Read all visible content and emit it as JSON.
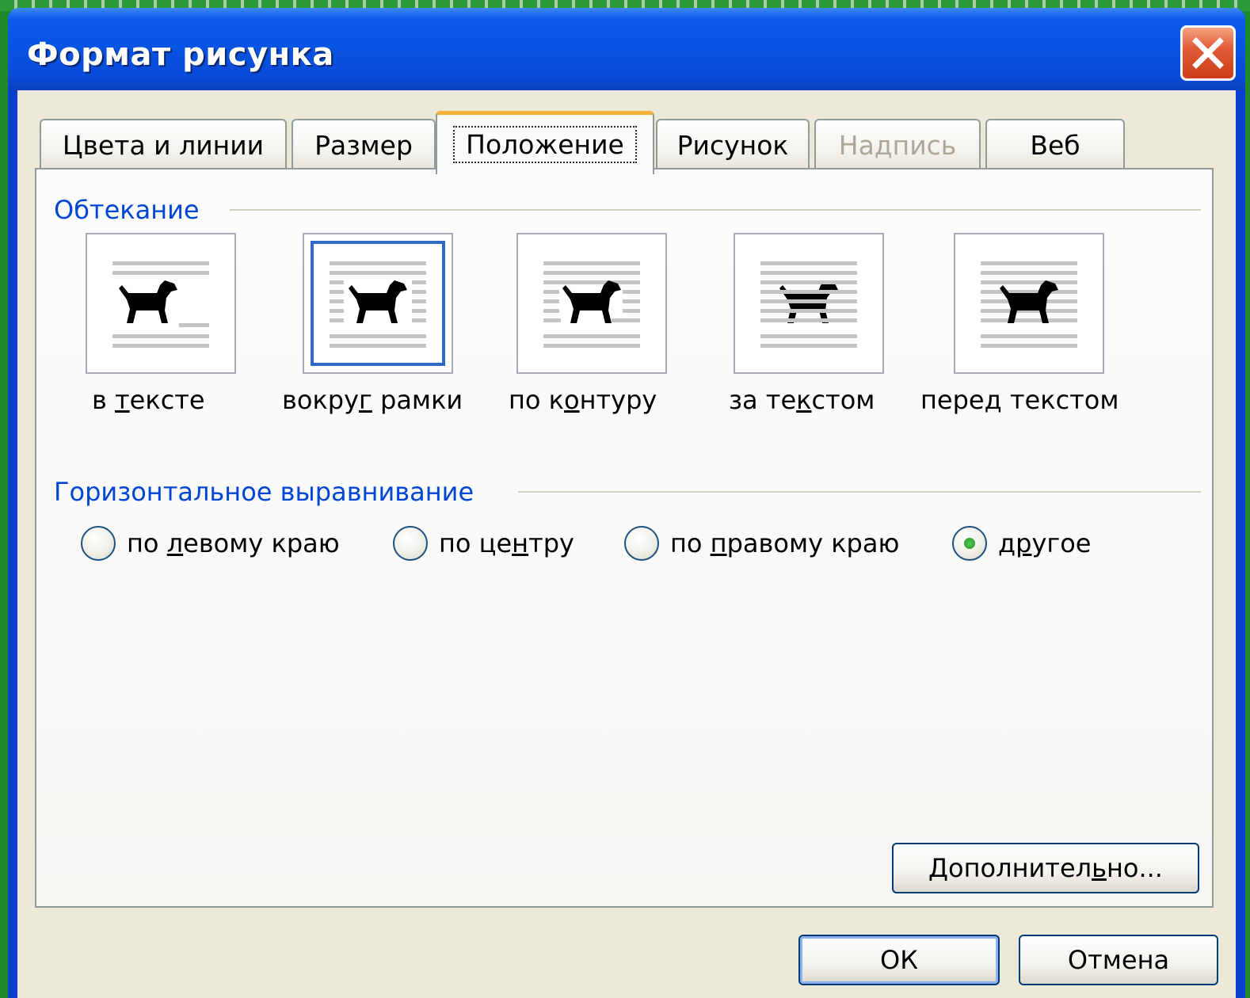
{
  "window": {
    "title": "Формат рисунка",
    "close_icon": "close-icon"
  },
  "tabs": [
    {
      "label": "Цвета и линии",
      "state": "normal"
    },
    {
      "label": "Размер",
      "state": "normal"
    },
    {
      "label": "Положение",
      "state": "active"
    },
    {
      "label": "Рисунок",
      "state": "normal"
    },
    {
      "label": "Надпись",
      "state": "disabled"
    },
    {
      "label": "Веб",
      "state": "normal"
    }
  ],
  "wrapping": {
    "group_label": "Обтекание",
    "options": [
      {
        "pre": "в ",
        "key": "т",
        "post": "ексте",
        "icon": "wrap-inline-icon",
        "selected": false
      },
      {
        "pre": "вокру",
        "key": "г",
        "post": " рамки",
        "icon": "wrap-square-icon",
        "selected": true
      },
      {
        "pre": "по к",
        "key": "о",
        "post": "нтуру",
        "icon": "wrap-tight-icon",
        "selected": false
      },
      {
        "pre": "за те",
        "key": "к",
        "post": "стом",
        "icon": "wrap-behind-icon",
        "selected": false
      },
      {
        "pre": "пере",
        "key": "д",
        "post": " текстом",
        "icon": "wrap-front-icon",
        "selected": false
      }
    ]
  },
  "horizontal_alignment": {
    "group_label": "Горизонтальное выравнивание",
    "options": [
      {
        "pre": "по ",
        "key": "л",
        "post": "евому краю",
        "checked": false
      },
      {
        "pre": "по це",
        "key": "н",
        "post": "тру",
        "checked": false
      },
      {
        "pre": "по ",
        "key": "п",
        "post": "равому краю",
        "checked": false
      },
      {
        "pre": "д",
        "key": "р",
        "post": "угое",
        "checked": true
      }
    ]
  },
  "buttons": {
    "advanced": {
      "pre": "Дополнител",
      "key": "ь",
      "post": "но..."
    },
    "ok": "ОК",
    "cancel": "Отмена"
  },
  "colors": {
    "title_bar": "#0753e2",
    "dialog_face": "#ece9d8",
    "group_label": "#0046d5",
    "active_tab_accent": "#f4b03a",
    "selection_frame": "#316ac5",
    "close_button": "#e25c37"
  }
}
